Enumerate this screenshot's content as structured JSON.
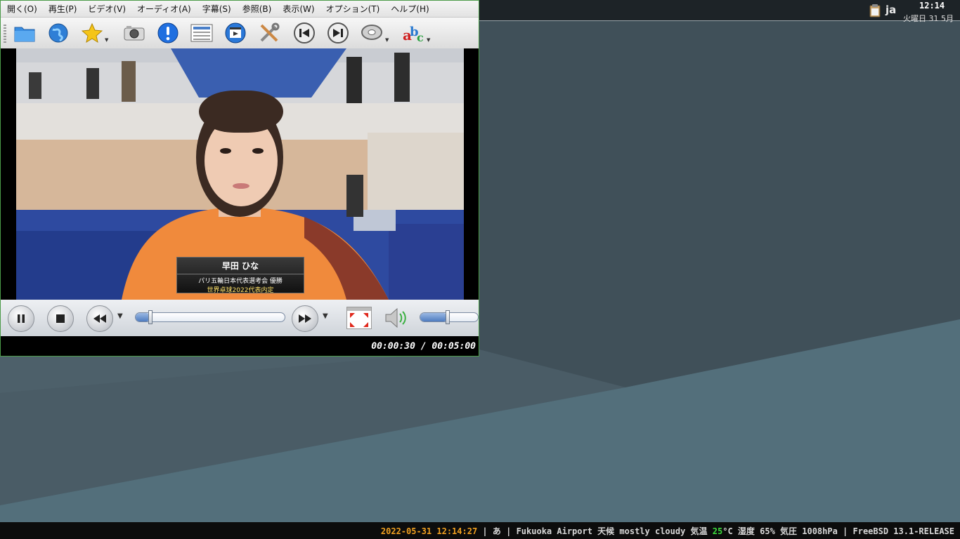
{
  "player": {
    "menus": [
      "開く(O)",
      "再生(P)",
      "ビデオ(V)",
      "オーディオ(A)",
      "字幕(S)",
      "参照(B)",
      "表示(W)",
      "オプション(T)",
      "ヘルプ(H)"
    ],
    "toolbar_icons": [
      "open-folder-icon",
      "open-url-globe-icon",
      "favorites-star-icon",
      "screenshot-camera-icon",
      "info-icon",
      "playlist-icon",
      "video-settings-icon",
      "preferences-tools-icon",
      "previous-track-icon",
      "next-track-icon",
      "audio-disc-icon",
      "subtitle-abc-icon"
    ],
    "caption": {
      "name": "早田 ひな",
      "line1": "パリ五輪日本代表選考会 優勝",
      "line2": "世界卓球2022代表内定"
    },
    "seek_progress": 0.1,
    "volume_level": 0.47,
    "time": "00:00:30 / 00:05:00"
  },
  "tray": {
    "lang": "ja",
    "clock": "12:14",
    "date": "火曜日 31 5月"
  },
  "statusbar": {
    "datetime": "2022-05-31 12:14:27",
    "sep1": " | ",
    "input": "あ",
    "sep2": " | ",
    "weather_pre": "Fukuoka Airport 天候 mostly cloudy  気温 ",
    "temp": "25",
    "weather_post": "°C 湿度 65% 気圧 1008hPa | FreeBSD 13.1-RELEASE"
  },
  "colors": {
    "accent": "#4e7cc0",
    "datetime": "#f0a020",
    "temp": "#3ddc3d"
  }
}
